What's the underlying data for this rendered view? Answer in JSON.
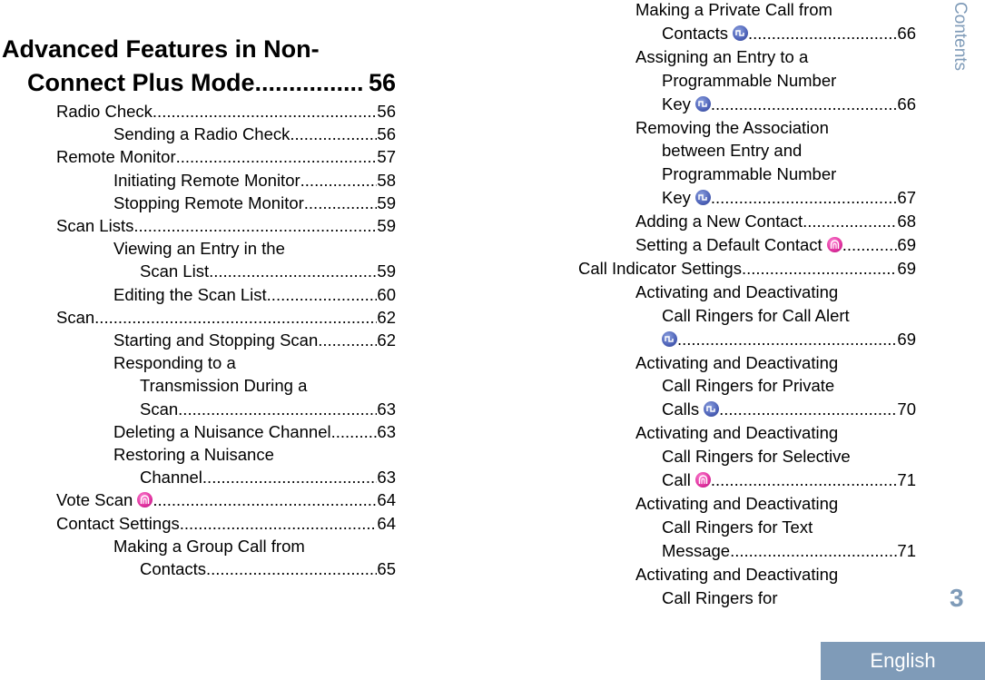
{
  "side_label": "Contents",
  "page_number": "3",
  "language_tab": "English",
  "heading": {
    "line1": "Advanced Features in Non-",
    "line2": "Connect Plus Mode",
    "page": "56"
  },
  "left_entries": [
    {
      "text": "Radio Check",
      "page": "56",
      "level": 1
    },
    {
      "text": "Sending a Radio Check",
      "page": "56",
      "level": 2
    },
    {
      "text": "Remote Monitor",
      "page": "57",
      "level": 1
    },
    {
      "text": "Initiating Remote Monitor",
      "page": "58",
      "level": 2
    },
    {
      "text": "Stopping Remote Monitor",
      "page": "59",
      "level": 2
    },
    {
      "text": "Scan Lists",
      "page": "59",
      "level": 1
    },
    {
      "text": "Viewing an Entry in the",
      "page": "",
      "level": 2
    },
    {
      "text": "Scan List",
      "page": "59",
      "level": 3
    },
    {
      "text": "Editing the Scan List",
      "page": "60",
      "level": 2
    },
    {
      "text": "Scan",
      "page": "62",
      "level": 1
    },
    {
      "text": "Starting and Stopping Scan",
      "page": "62",
      "level": 2
    },
    {
      "text": "Responding to a",
      "page": "",
      "level": 2
    },
    {
      "text": "Transmission During a",
      "page": "",
      "level": 3
    },
    {
      "text": "Scan",
      "page": "63",
      "level": 3
    },
    {
      "text": "Deleting a Nuisance Channel",
      "page": "63",
      "level": 2
    },
    {
      "text": "Restoring a Nuisance",
      "page": "",
      "level": 2
    },
    {
      "text": "Channel",
      "page": "63",
      "level": 3
    },
    {
      "text": "Vote Scan",
      "page": "64",
      "level": 1,
      "icon": "pink-connect-plus-icon"
    },
    {
      "text": "Contact Settings",
      "page": "64",
      "level": 1
    },
    {
      "text": "Making a Group Call from",
      "page": "",
      "level": 2
    },
    {
      "text": "Contacts",
      "page": "65",
      "level": 3
    }
  ],
  "right_entries": [
    {
      "text": "Making a Private Call from",
      "page": "",
      "level": 2
    },
    {
      "text": "Contacts",
      "page": "66",
      "level": 3,
      "icon": "blue-digital-icon"
    },
    {
      "text": "Assigning an Entry to a",
      "page": "",
      "level": 2
    },
    {
      "text": "Programmable Number",
      "page": "",
      "level": 3
    },
    {
      "text": "Key",
      "page": "66",
      "level": 3,
      "icon": "blue-digital-icon"
    },
    {
      "text": "Removing the Association",
      "page": "",
      "level": 2
    },
    {
      "text": "between Entry and",
      "page": "",
      "level": 3
    },
    {
      "text": "Programmable Number",
      "page": "",
      "level": 3
    },
    {
      "text": "Key",
      "page": "67",
      "level": 3,
      "icon": "blue-digital-icon"
    },
    {
      "text": "Adding a New Contact",
      "page": "68",
      "level": 2
    },
    {
      "text": "Setting a Default Contact",
      "page": "69",
      "level": 2,
      "icon": "pink-connect-plus-icon"
    },
    {
      "text": "Call Indicator Settings",
      "page": "69",
      "level": 1
    },
    {
      "text": "Activating and Deactivating",
      "page": "",
      "level": 2
    },
    {
      "text": "Call Ringers for Call Alert",
      "page": "",
      "level": 3
    },
    {
      "text": "",
      "page": "69",
      "level": 3,
      "icon": "blue-digital-icon"
    },
    {
      "text": "Activating and Deactivating",
      "page": "",
      "level": 2
    },
    {
      "text": "Call Ringers for Private",
      "page": "",
      "level": 3
    },
    {
      "text": "Calls",
      "page": "70",
      "level": 3,
      "icon": "blue-digital-icon"
    },
    {
      "text": "Activating and Deactivating",
      "page": "",
      "level": 2
    },
    {
      "text": "Call Ringers for Selective",
      "page": "",
      "level": 3
    },
    {
      "text": "Call",
      "page": "71",
      "level": 3,
      "icon": "pink-connect-plus-icon"
    },
    {
      "text": "Activating and Deactivating",
      "page": "",
      "level": 2
    },
    {
      "text": "Call Ringers for Text",
      "page": "",
      "level": 3
    },
    {
      "text": "Message",
      "page": "71",
      "level": 3
    },
    {
      "text": "Activating and Deactivating",
      "page": "",
      "level": 2
    },
    {
      "text": "Call Ringers for",
      "page": "",
      "level": 3
    }
  ],
  "colors": {
    "accent": "#7f9bb8",
    "icon_blue": "#4d62b8",
    "icon_pink": "#e0309e"
  }
}
